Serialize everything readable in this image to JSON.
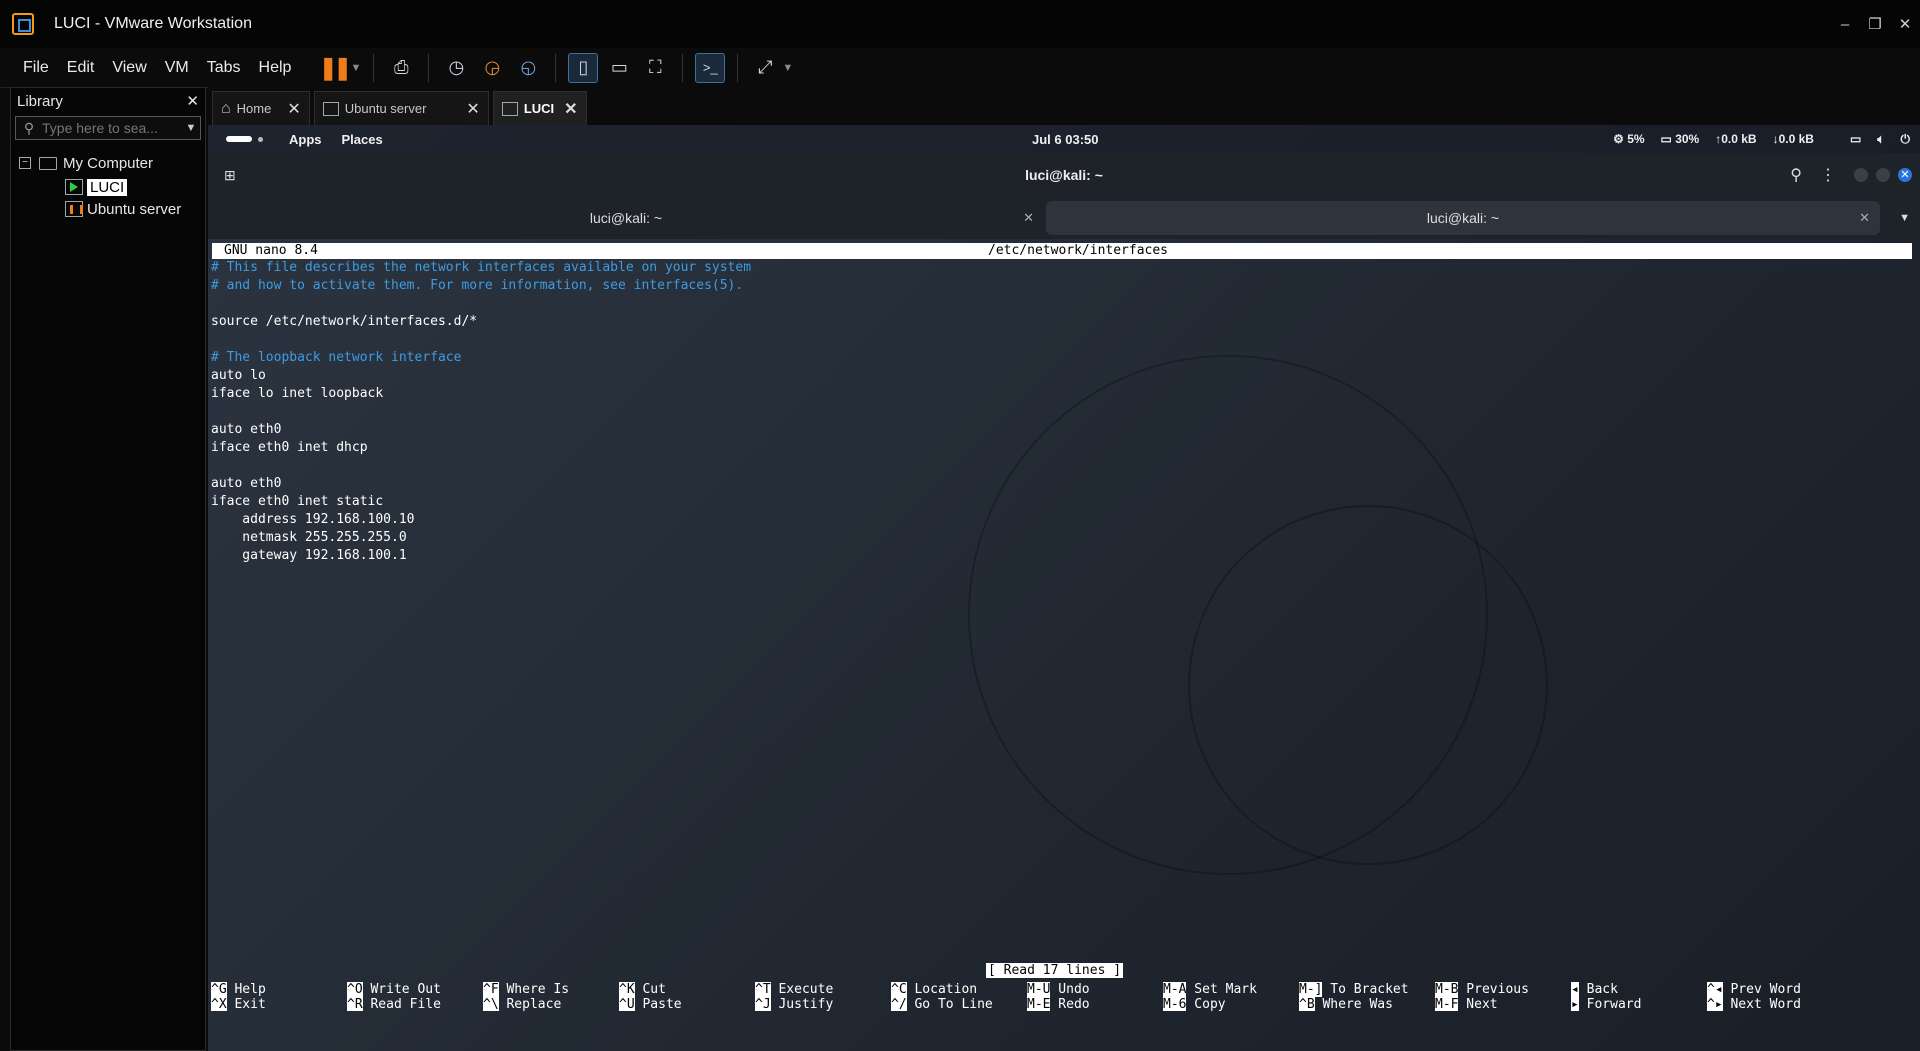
{
  "window": {
    "title": "LUCI - VMware Workstation",
    "controls": [
      "–",
      "❐",
      "✕"
    ]
  },
  "menu": [
    "File",
    "Edit",
    "View",
    "VM",
    "Tabs",
    "Help"
  ],
  "library": {
    "title": "Library",
    "search_placeholder": "Type here to sea...",
    "tree": {
      "root": "My Computer",
      "items": [
        "LUCI",
        "Ubuntu server"
      ]
    }
  },
  "vm_tabs": [
    {
      "label": "Home",
      "icon": "home-icon"
    },
    {
      "label": "Ubuntu server",
      "icon": "vm-paused-icon"
    },
    {
      "label": "LUCI",
      "icon": "vm-running-icon"
    }
  ],
  "guest": {
    "topbar": {
      "menus": [
        "Apps",
        "Places"
      ],
      "clock": "Jul 6  03:50",
      "cpu": "5%",
      "mem": "30%",
      "net_up": "↑0.0 kB",
      "net_down": "↓0.0 kB"
    },
    "terminal": {
      "title": "luci@kali: ~",
      "tabs": [
        "luci@kali: ~",
        "luci@kali: ~"
      ]
    },
    "nano": {
      "version": "GNU nano 8.4",
      "file": "/etc/network/interfaces",
      "lines": [
        {
          "t": "# This file describes the network interfaces available on your system",
          "c": true
        },
        {
          "t": "# and how to activate them. For more information, see interfaces(5).",
          "c": true
        },
        {
          "t": "",
          "c": false
        },
        {
          "t": "source /etc/network/interfaces.d/*",
          "c": false
        },
        {
          "t": "",
          "c": false
        },
        {
          "t": "# The loopback network interface",
          "c": true
        },
        {
          "t": "auto lo",
          "c": false
        },
        {
          "t": "iface lo inet loopback",
          "c": false
        },
        {
          "t": "",
          "c": false
        },
        {
          "t": "auto eth0",
          "c": false
        },
        {
          "t": "iface eth0 inet dhcp",
          "c": false
        },
        {
          "t": "",
          "c": false
        },
        {
          "t": "auto eth0",
          "c": false
        },
        {
          "t": "iface eth0 inet static",
          "c": false
        },
        {
          "t": "    address 192.168.100.10",
          "c": false
        },
        {
          "t": "    netmask 255.255.255.0",
          "c": false
        },
        {
          "t": "    gateway 192.168.100.1",
          "c": false
        }
      ],
      "status": "[ Read 17 lines ]",
      "shortcuts_row1": [
        {
          "k": "^G",
          "l": "Help"
        },
        {
          "k": "^O",
          "l": "Write Out"
        },
        {
          "k": "^F",
          "l": "Where Is"
        },
        {
          "k": "^K",
          "l": "Cut"
        },
        {
          "k": "^T",
          "l": "Execute"
        },
        {
          "k": "^C",
          "l": "Location"
        },
        {
          "k": "M-U",
          "l": "Undo"
        },
        {
          "k": "M-A",
          "l": "Set Mark"
        },
        {
          "k": "M-]",
          "l": "To Bracket"
        },
        {
          "k": "M-B",
          "l": "Previous"
        },
        {
          "k": "◂",
          "l": "Back"
        },
        {
          "k": "^◂",
          "l": "Prev Word"
        }
      ],
      "shortcuts_row2": [
        {
          "k": "^X",
          "l": "Exit"
        },
        {
          "k": "^R",
          "l": "Read File"
        },
        {
          "k": "^\\",
          "l": "Replace"
        },
        {
          "k": "^U",
          "l": "Paste"
        },
        {
          "k": "^J",
          "l": "Justify"
        },
        {
          "k": "^/",
          "l": "Go To Line"
        },
        {
          "k": "M-E",
          "l": "Redo"
        },
        {
          "k": "M-6",
          "l": "Copy"
        },
        {
          "k": "^B",
          "l": "Where Was"
        },
        {
          "k": "M-F",
          "l": "Next"
        },
        {
          "k": "▸",
          "l": "Forward"
        },
        {
          "k": "^▸",
          "l": "Next Word"
        }
      ]
    }
  }
}
